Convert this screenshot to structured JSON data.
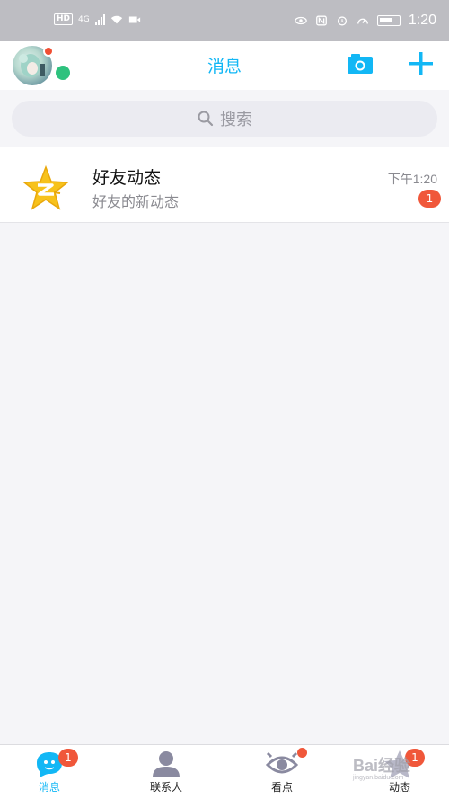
{
  "status_bar": {
    "hd": "HD",
    "network": "4G",
    "time": "1:20"
  },
  "header": {
    "title": "消息",
    "avatar_badge": true
  },
  "search": {
    "placeholder": "搜索",
    "icon": "search-icon"
  },
  "conversations": [
    {
      "title": "好友动态",
      "subtitle": "好友的新动态",
      "time": "下午1:20",
      "unread": "1",
      "icon": "qzone-star-icon"
    }
  ],
  "bottom_nav": {
    "tabs": [
      {
        "label": "消息",
        "badge": "1",
        "active": true,
        "icon": "message-bubble-icon"
      },
      {
        "label": "联系人",
        "badge": "",
        "active": false,
        "icon": "contacts-icon"
      },
      {
        "label": "看点",
        "badge": "dot",
        "active": false,
        "icon": "eye-icon"
      },
      {
        "label": "动态",
        "badge": "1",
        "active": false,
        "icon": "star-icon"
      }
    ]
  },
  "watermark": {
    "text": "Bai经验",
    "sub": "jingyan.baidu.com"
  },
  "colors": {
    "accent": "#12b7f5",
    "badge": "#f0573a",
    "online": "#2ec27e",
    "statusbar": "#bdbdc2",
    "background": "#f5f5f8"
  }
}
